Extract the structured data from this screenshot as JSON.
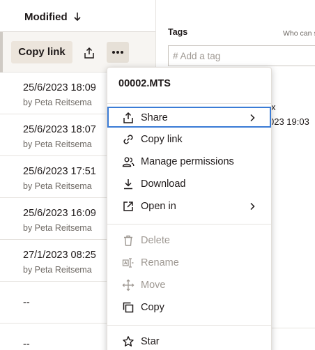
{
  "list": {
    "column_header": "Modified",
    "selected_row": {
      "copy_link_label": "Copy link"
    },
    "rows": [
      {
        "date": "25/6/2023 18:09",
        "by": "by Peta Reitsema"
      },
      {
        "date": "25/6/2023 18:07",
        "by": "by Peta Reitsema"
      },
      {
        "date": "25/6/2023 17:51",
        "by": "by Peta Reitsema"
      },
      {
        "date": "25/6/2023 16:09",
        "by": "by Peta Reitsema"
      },
      {
        "date": "27/1/2023 08:25",
        "by": "by Peta Reitsema"
      },
      {
        "dash": "--"
      },
      {
        "dash": "--"
      }
    ]
  },
  "details": {
    "tags_label": "Tags",
    "who_label": "Who can s",
    "tag_placeholder": "# Add a tag",
    "frag1": "x",
    "frag2": "023 19:03"
  },
  "menu": {
    "title": "00002.MTS",
    "items": [
      {
        "label": "Share",
        "icon": "share-icon",
        "submenu": true,
        "focused": true
      },
      {
        "label": "Copy link",
        "icon": "link-icon"
      },
      {
        "label": "Manage permissions",
        "icon": "people-icon"
      },
      {
        "label": "Download",
        "icon": "download-icon"
      },
      {
        "label": "Open in",
        "icon": "open-in-icon",
        "submenu": true
      },
      {
        "label": "Delete",
        "icon": "trash-icon",
        "disabled": true
      },
      {
        "label": "Rename",
        "icon": "rename-icon",
        "disabled": true
      },
      {
        "label": "Move",
        "icon": "move-icon",
        "disabled": true
      },
      {
        "label": "Copy",
        "icon": "copy-icon"
      },
      {
        "label": "Star",
        "icon": "star-icon"
      }
    ]
  },
  "colors": {
    "focus_ring": "#3a7bd5",
    "selected_row_bg": "#f7f5f2",
    "button_bg": "#ece5dc",
    "disabled_text": "#9e9892",
    "secondary_text": "#6f6a65"
  }
}
